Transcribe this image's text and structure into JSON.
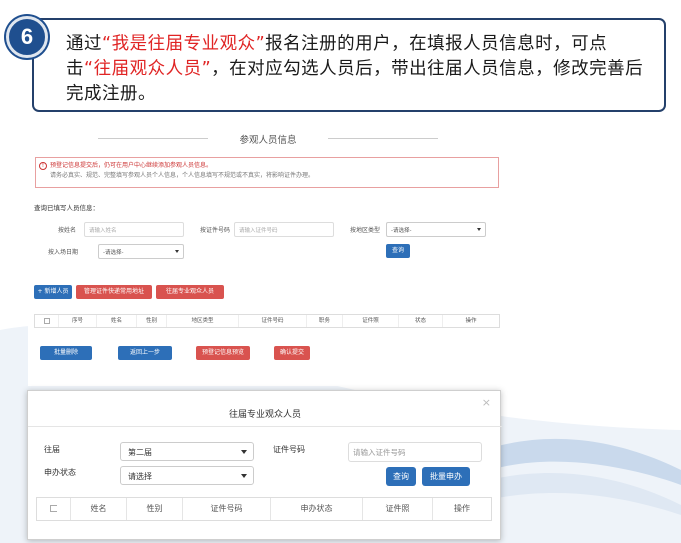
{
  "step": {
    "number": "6",
    "text_1": "通过",
    "hl_1": "“我是往届专业观众”",
    "text_2": "报名注册的用户，在填报人员信息时，可点击",
    "hl_2": "“往届观众人员”",
    "text_3": "，在对应勾选人员后，带出往届人员信息，修改完善后完成注册。",
    "highlight_color": "#e02424",
    "badge_color": "#1f4f8f"
  },
  "form": {
    "section_title": "参观人员信息",
    "warning_line1": "预登记信息提交后，仍可在用户中心继续添加参观人员信息。",
    "warning_line2": "请务必真实、规范、完整填写参观人员个人信息，个人信息填写不规范或不真实，将影响证件办理。",
    "query_label": "查询已填写人员信息：",
    "name_label": "按姓名",
    "name_placeholder": "请输入姓名",
    "cert_label": "按证件号码",
    "cert_placeholder": "请输入证件号码",
    "region_label": "按地区类型",
    "region_value": "-请选择-",
    "date_label": "按入场日期",
    "date_value": "-请选择-",
    "query_button": "查询",
    "add_button": "+ 新增人员",
    "manage_button": "管理证件快递常用地址",
    "past_button": "往届专业观众人员",
    "table_headers": [
      "序号",
      "姓名",
      "性别",
      "地区类型",
      "证件号码",
      "职务",
      "证件照",
      "状态",
      "操作"
    ],
    "batch_delete": "批量删除",
    "back_button": "返回上一步",
    "preview_button": "预登记信息预览",
    "confirm_button": "确认提交"
  },
  "modal": {
    "title": "往届专业观众人员",
    "close": "×",
    "session_label": "往届",
    "session_value": "第二届",
    "status_label": "申办状态",
    "status_value": "请选择",
    "cert_label": "证件号码",
    "cert_placeholder": "请输入证件号码",
    "query_button": "查询",
    "batch_apply_button": "批量申办",
    "table_headers": [
      "姓名",
      "性别",
      "证件号码",
      "申办状态",
      "证件照",
      "操作"
    ]
  }
}
